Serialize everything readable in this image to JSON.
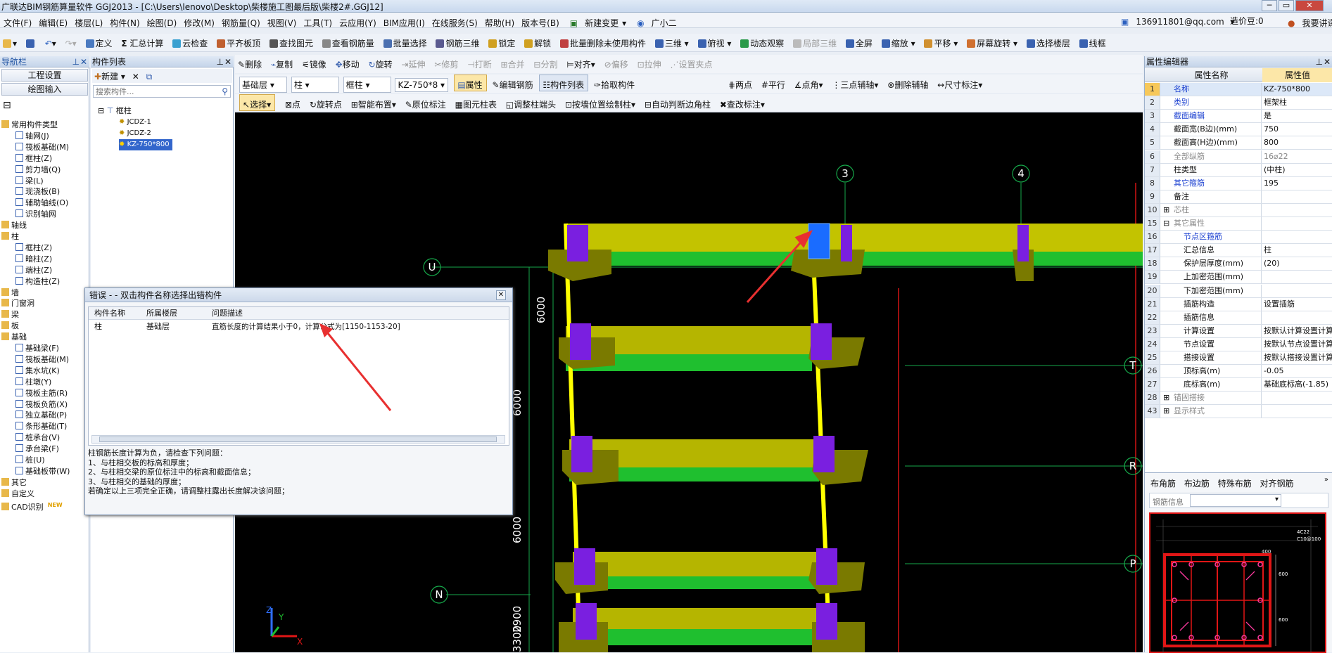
{
  "window": {
    "title": "广联达BIM钢筋算量软件 GGJ2013 - [C:\\Users\\lenovo\\Desktop\\柴楼施工图最后版\\柴楼2#.GGJ12]",
    "minimize": "─",
    "restore": "▭",
    "close": "✕"
  },
  "menu": [
    "文件(F)",
    "编辑(E)",
    "楼层(L)",
    "构件(N)",
    "绘图(D)",
    "修改(M)",
    "钢筋量(Q)",
    "视图(V)",
    "工具(T)",
    "云应用(Y)",
    "BIM应用(I)",
    "在线服务(S)",
    "帮助(H)",
    "版本号(B)",
    "新建变更",
    "广小二"
  ],
  "account": {
    "email": "136911801@qq.com",
    "coins": "造价豆:0",
    "want_lecture": "我要讲课"
  },
  "toolbar1": [
    "定义",
    "汇总计算",
    "云检查",
    "平齐板顶",
    "查找图元",
    "查看钢筋量",
    "批量选择",
    "钢筋三维",
    "锁定",
    "解锁",
    "批量删除未使用构件",
    "三维",
    "俯视",
    "动态观察",
    "局部三维",
    "全屏",
    "缩放",
    "平移",
    "屏幕旋转",
    "选择楼层",
    "线框"
  ],
  "toolbar2": [
    "删除",
    "复制",
    "镜像",
    "移动",
    "旋转",
    "延伸",
    "修剪",
    "打断",
    "合并",
    "分割",
    "对齐",
    "偏移",
    "拉伸",
    "设置夹点"
  ],
  "toolbar3": {
    "floor": "基础层",
    "type1": "柱",
    "type2": "框柱",
    "component": "KZ-750*8",
    "buttons": [
      "属性",
      "编辑钢筋",
      "构件列表",
      "拾取构件"
    ],
    "aux": [
      "两点",
      "平行",
      "点角",
      "三点辅轴",
      "删除辅轴",
      "尺寸标注"
    ]
  },
  "toolbar4": [
    "选择",
    "点",
    "旋转点",
    "智能布置",
    "原位标注",
    "图元柱表",
    "调整柱端头",
    "按墙位置绘制柱",
    "自动判断边角柱",
    "查改标注"
  ],
  "nav": {
    "title": "导航栏",
    "btn_project": "工程设置",
    "btn_draw": "绘图输入",
    "tree": [
      [
        "常用构件类型",
        0,
        "folder"
      ],
      [
        "轴网(J)",
        1,
        "grid"
      ],
      [
        "筏板基础(M)",
        1,
        "raft"
      ],
      [
        "框柱(Z)",
        1,
        "col"
      ],
      [
        "剪力墙(Q)",
        1,
        "wall"
      ],
      [
        "梁(L)",
        1,
        "beam"
      ],
      [
        "现浇板(B)",
        1,
        "slab"
      ],
      [
        "辅助轴线(O)",
        1,
        "axis"
      ],
      [
        "识别轴网",
        1,
        "axis"
      ],
      [
        "轴线",
        0,
        "folder"
      ],
      [
        "柱",
        0,
        "folder"
      ],
      [
        "框柱(Z)",
        1,
        "col"
      ],
      [
        "暗柱(Z)",
        1,
        "col"
      ],
      [
        "端柱(Z)",
        1,
        "col"
      ],
      [
        "构造柱(Z)",
        1,
        "col"
      ],
      [
        "墙",
        0,
        "folder"
      ],
      [
        "门窗洞",
        0,
        "folder"
      ],
      [
        "梁",
        0,
        "folder"
      ],
      [
        "板",
        0,
        "folder"
      ],
      [
        "基础",
        0,
        "folder"
      ],
      [
        "基础梁(F)",
        1,
        "beam"
      ],
      [
        "筏板基础(M)",
        1,
        "raft"
      ],
      [
        "集水坑(K)",
        1,
        "pit"
      ],
      [
        "柱墩(Y)",
        1,
        "col"
      ],
      [
        "筏板主筋(R)",
        1,
        "bar"
      ],
      [
        "筏板负筋(X)",
        1,
        "bar"
      ],
      [
        "独立基础(P)",
        1,
        "raft"
      ],
      [
        "条形基础(T)",
        1,
        "raft"
      ],
      [
        "桩承台(V)",
        1,
        "raft"
      ],
      [
        "承台梁(F)",
        1,
        "beam"
      ],
      [
        "桩(U)",
        1,
        "col"
      ],
      [
        "基础板带(W)",
        1,
        "bar"
      ],
      [
        "其它",
        0,
        "folder"
      ],
      [
        "自定义",
        0,
        "folder"
      ],
      [
        "CAD识别",
        0,
        "folder"
      ]
    ],
    "new_badge": "NEW"
  },
  "complist": {
    "title": "构件列表",
    "new_btn": "新建",
    "search_placeholder": "搜索构件...",
    "root": "框柱",
    "items": [
      "JCDZ-1",
      "JCDZ-2",
      "KZ-750*800"
    ]
  },
  "dialog": {
    "title": "错误 - - 双击构件名称选择出错构件",
    "headers": [
      "构件名称",
      "所属楼层",
      "问题描述"
    ],
    "row": [
      "柱",
      "基础层",
      "直筋长度的计算结果小于0，计算公式为[1150-1153-20]"
    ],
    "hint": [
      "柱钢筋长度计算为负，请检查下列问题：",
      "1、与柱相交板的标高和厚度；",
      "2、与柱相交梁的原位标注中的标高和截面信息；",
      "3、与柱相交的基础的厚度；",
      "若确定以上三项完全正确，请调整柱露出长度解决该问题；"
    ]
  },
  "props": {
    "title": "属性编辑器",
    "col_name": "属性名称",
    "col_value": "属性值",
    "rows": [
      [
        "1",
        "名称",
        "KZ-750*800"
      ],
      [
        "2",
        "类别",
        "框架柱"
      ],
      [
        "3",
        "截面编辑",
        "是"
      ],
      [
        "4",
        "截面宽(B边)(mm)",
        "750"
      ],
      [
        "5",
        "截面高(H边)(mm)",
        "800"
      ],
      [
        "6",
        "全部纵筋",
        "16⌀22"
      ],
      [
        "7",
        "柱类型",
        "(中柱)"
      ],
      [
        "8",
        "其它箍筋",
        "195"
      ],
      [
        "9",
        "备注",
        ""
      ],
      [
        "10",
        "芯柱",
        ""
      ],
      [
        "15",
        "其它属性",
        ""
      ],
      [
        "16",
        "节点区箍筋",
        ""
      ],
      [
        "17",
        "汇总信息",
        "柱"
      ],
      [
        "18",
        "保护层厚度(mm)",
        "(20)"
      ],
      [
        "19",
        "上加密范围(mm)",
        ""
      ],
      [
        "20",
        "下加密范围(mm)",
        ""
      ],
      [
        "21",
        "插筋构造",
        "设置插筋"
      ],
      [
        "22",
        "插筋信息",
        ""
      ],
      [
        "23",
        "计算设置",
        "按默认计算设置计算"
      ],
      [
        "24",
        "节点设置",
        "按默认节点设置计算"
      ],
      [
        "25",
        "搭接设置",
        "按默认搭接设置计算"
      ],
      [
        "26",
        "顶标高(m)",
        "-0.05"
      ],
      [
        "27",
        "底标高(m)",
        "基础底标高(-1.85)"
      ],
      [
        "28",
        "锚固搭接",
        ""
      ],
      [
        "43",
        "显示样式",
        ""
      ]
    ],
    "tabs": [
      "布角筋",
      "布边筋",
      "特殊布筋",
      "对齐钢筋"
    ],
    "rebar_info": "钢筋信息"
  },
  "canvas": {
    "axes": [
      "3",
      "4",
      "U",
      "T",
      "R",
      "P",
      "N"
    ],
    "dims": [
      "6000",
      "6000",
      "2900",
      "6000",
      "3300"
    ],
    "coord": [
      "Z",
      "Y",
      "X"
    ],
    "rebar_labels": [
      "4C22",
      "C10@100",
      "600",
      "400"
    ]
  },
  "colors": {
    "beam": "#b5b500",
    "beam_side": "#7a7a00",
    "col": "#7a1fe0",
    "green": "#1fbf2f",
    "grid": "#16a84a",
    "red": "#e01616",
    "select": "#1a6cff"
  }
}
